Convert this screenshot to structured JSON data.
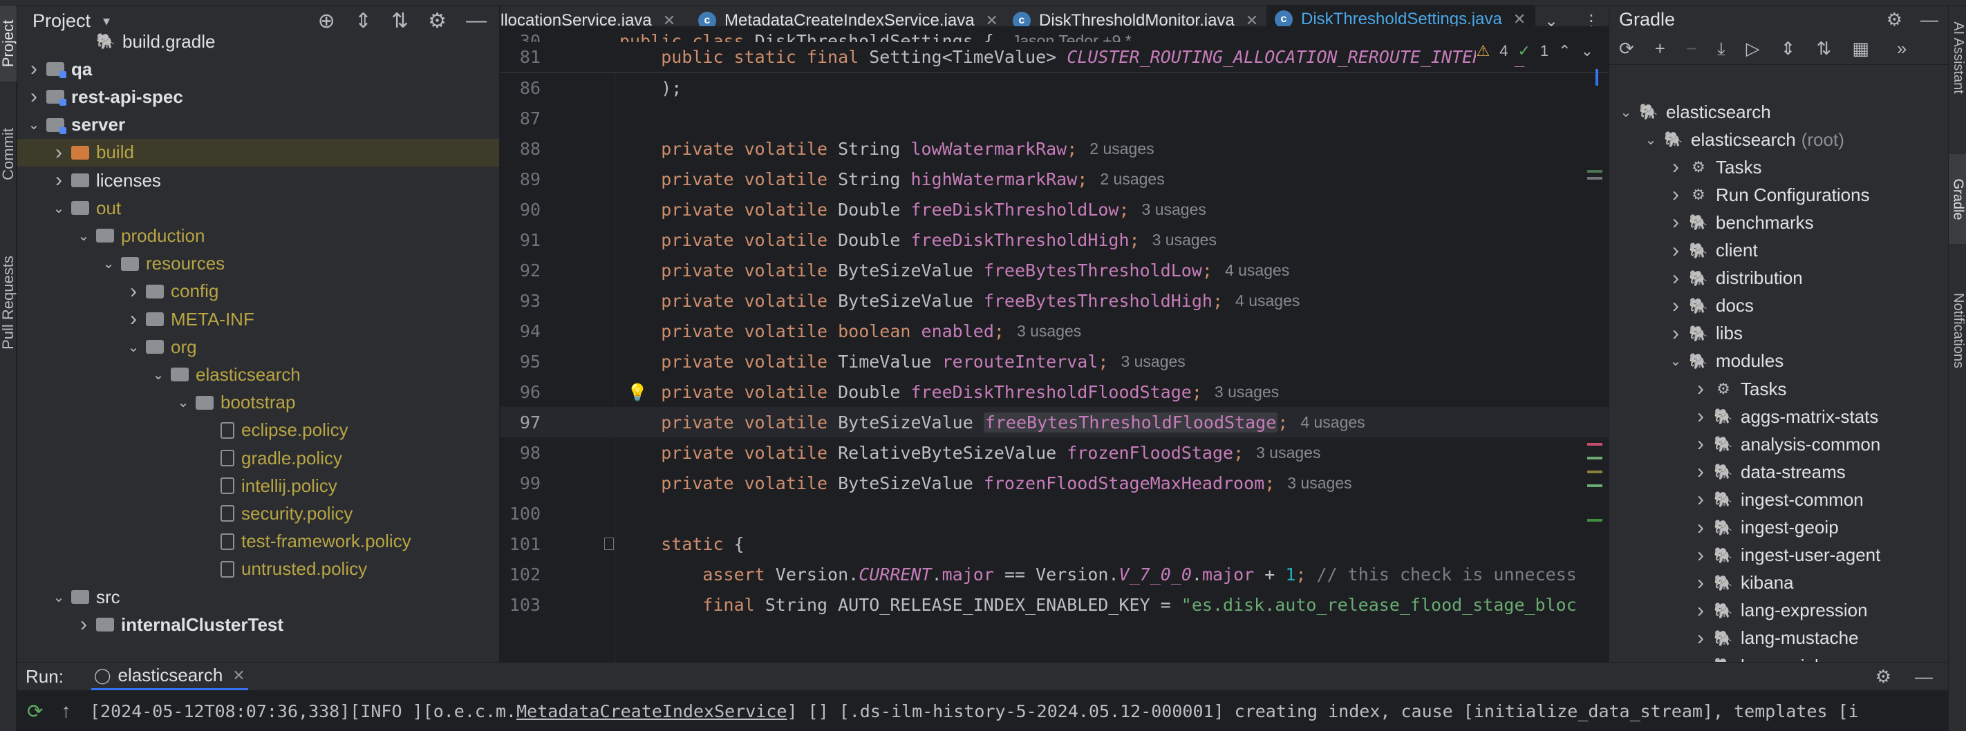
{
  "left_stripe": {
    "tabs": [
      "Project",
      "Commit",
      "Pull Requests"
    ]
  },
  "right_stripe": {
    "tabs": [
      "AI Assistant",
      "Gradle",
      "Notifications"
    ]
  },
  "project_panel": {
    "title": "Project",
    "tree": [
      {
        "label": "build.gradle",
        "kind": "gradle",
        "indent": 3,
        "arrow": ""
      },
      {
        "label": "qa",
        "kind": "mod",
        "indent": 1,
        "arrow": "right",
        "style": "bold"
      },
      {
        "label": "rest-api-spec",
        "kind": "mod",
        "indent": 1,
        "arrow": "right",
        "style": "bold"
      },
      {
        "label": "server",
        "kind": "mod",
        "indent": 1,
        "arrow": "down",
        "style": "bold"
      },
      {
        "label": "build",
        "kind": "orange",
        "indent": 2,
        "arrow": "right",
        "style": "yellow",
        "highlight": true
      },
      {
        "label": "licenses",
        "kind": "grey",
        "indent": 2,
        "arrow": "right",
        "style": "normal"
      },
      {
        "label": "out",
        "kind": "grey",
        "indent": 2,
        "arrow": "down",
        "style": "yellow"
      },
      {
        "label": "production",
        "kind": "grey",
        "indent": 3,
        "arrow": "down",
        "style": "yellow"
      },
      {
        "label": "resources",
        "kind": "grey",
        "indent": 4,
        "arrow": "down",
        "style": "yellow"
      },
      {
        "label": "config",
        "kind": "grey",
        "indent": 5,
        "arrow": "right",
        "style": "yellow"
      },
      {
        "label": "META-INF",
        "kind": "grey",
        "indent": 5,
        "arrow": "right",
        "style": "yellow"
      },
      {
        "label": "org",
        "kind": "grey",
        "indent": 5,
        "arrow": "down",
        "style": "yellow"
      },
      {
        "label": "elasticsearch",
        "kind": "grey",
        "indent": 6,
        "arrow": "down",
        "style": "yellow"
      },
      {
        "label": "bootstrap",
        "kind": "grey",
        "indent": 7,
        "arrow": "down",
        "style": "yellow"
      },
      {
        "label": "eclipse.policy",
        "kind": "file",
        "indent": 8,
        "arrow": "",
        "style": "yellow"
      },
      {
        "label": "gradle.policy",
        "kind": "file",
        "indent": 8,
        "arrow": "",
        "style": "yellow"
      },
      {
        "label": "intellij.policy",
        "kind": "file",
        "indent": 8,
        "arrow": "",
        "style": "yellow"
      },
      {
        "label": "security.policy",
        "kind": "file",
        "indent": 8,
        "arrow": "",
        "style": "yellow"
      },
      {
        "label": "test-framework.policy",
        "kind": "file",
        "indent": 8,
        "arrow": "",
        "style": "yellow"
      },
      {
        "label": "untrusted.policy",
        "kind": "file",
        "indent": 8,
        "arrow": "",
        "style": "yellow"
      },
      {
        "label": "src",
        "kind": "grey",
        "indent": 2,
        "arrow": "down",
        "style": "normal"
      },
      {
        "label": "internalClusterTest",
        "kind": "grey",
        "indent": 3,
        "arrow": "right",
        "style": "bold"
      }
    ]
  },
  "editor": {
    "tabs": [
      {
        "label": "llocationService.java",
        "active": false
      },
      {
        "label": "MetadataCreateIndexService.java",
        "active": false
      },
      {
        "label": "DiskThresholdMonitor.java",
        "active": false
      },
      {
        "label": "DiskThresholdSettings.java",
        "active": true
      }
    ],
    "inspection": {
      "warnings": "4",
      "ok": "1"
    },
    "author_hint": "Jason Tedor +9 *",
    "lines": [
      {
        "n": "30",
        "sticky": true,
        "tokens": [
          [
            "kw",
            "public class "
          ],
          [
            "ty",
            "DiskThresholdSettings "
          ],
          [
            "plain",
            "{"
          ]
        ],
        "author": true
      },
      {
        "n": "81",
        "sticky": true,
        "tokens": [
          [
            "plain",
            "    "
          ],
          [
            "kw",
            "public static final "
          ],
          [
            "ty",
            "Setting<TimeValue> "
          ],
          [
            "fldi",
            "CLUSTER_ROUTING_ALLOCATION_REROUTE_INTERVAL_SETTI"
          ]
        ]
      },
      {
        "n": "86",
        "tokens": [
          [
            "plain",
            "    );"
          ]
        ]
      },
      {
        "n": "87",
        "tokens": []
      },
      {
        "n": "88",
        "tokens": [
          [
            "plain",
            "    "
          ],
          [
            "kw",
            "private volatile "
          ],
          [
            "ty",
            "String "
          ],
          [
            "fld",
            "lowWatermarkRaw"
          ],
          [
            "pun",
            ";"
          ]
        ],
        "usages": "2 usages"
      },
      {
        "n": "89",
        "tokens": [
          [
            "plain",
            "    "
          ],
          [
            "kw",
            "private volatile "
          ],
          [
            "ty",
            "String "
          ],
          [
            "fld",
            "highWatermarkRaw"
          ],
          [
            "pun",
            ";"
          ]
        ],
        "usages": "2 usages"
      },
      {
        "n": "90",
        "tokens": [
          [
            "plain",
            "    "
          ],
          [
            "kw",
            "private volatile "
          ],
          [
            "ty",
            "Double "
          ],
          [
            "fld",
            "freeDiskThresholdLow"
          ],
          [
            "pun",
            ";"
          ]
        ],
        "usages": "3 usages"
      },
      {
        "n": "91",
        "tokens": [
          [
            "plain",
            "    "
          ],
          [
            "kw",
            "private volatile "
          ],
          [
            "ty",
            "Double "
          ],
          [
            "fld",
            "freeDiskThresholdHigh"
          ],
          [
            "pun",
            ";"
          ]
        ],
        "usages": "3 usages"
      },
      {
        "n": "92",
        "tokens": [
          [
            "plain",
            "    "
          ],
          [
            "kw",
            "private volatile "
          ],
          [
            "ty",
            "ByteSizeValue "
          ],
          [
            "fld",
            "freeBytesThresholdLow"
          ],
          [
            "pun",
            ";"
          ]
        ],
        "usages": "4 usages"
      },
      {
        "n": "93",
        "tokens": [
          [
            "plain",
            "    "
          ],
          [
            "kw",
            "private volatile "
          ],
          [
            "ty",
            "ByteSizeValue "
          ],
          [
            "fld",
            "freeBytesThresholdHigh"
          ],
          [
            "pun",
            ";"
          ]
        ],
        "usages": "4 usages"
      },
      {
        "n": "94",
        "tokens": [
          [
            "plain",
            "    "
          ],
          [
            "kw",
            "private volatile boolean "
          ],
          [
            "fld",
            "enabled"
          ],
          [
            "pun",
            ";"
          ]
        ],
        "usages": "3 usages"
      },
      {
        "n": "95",
        "tokens": [
          [
            "plain",
            "    "
          ],
          [
            "kw",
            "private volatile "
          ],
          [
            "ty",
            "TimeValue "
          ],
          [
            "fld",
            "rerouteInterval"
          ],
          [
            "pun",
            ";"
          ]
        ],
        "usages": "3 usages"
      },
      {
        "n": "96",
        "tokens": [
          [
            "plain",
            "    "
          ],
          [
            "kw",
            "private volatile "
          ],
          [
            "ty",
            "Double "
          ],
          [
            "fld",
            "freeDiskThresholdFloodStage"
          ],
          [
            "pun",
            ";"
          ]
        ],
        "usages": "3 usages",
        "bulb": true
      },
      {
        "n": "97",
        "tokens": [
          [
            "plain",
            "    "
          ],
          [
            "kw",
            "private volatile "
          ],
          [
            "ty",
            "ByteSizeValue "
          ],
          [
            "fldbox",
            "freeBytesThresholdFloodStage"
          ],
          [
            "pun",
            ";"
          ]
        ],
        "usages": "4 usages",
        "current": true
      },
      {
        "n": "98",
        "tokens": [
          [
            "plain",
            "    "
          ],
          [
            "kw",
            "private volatile "
          ],
          [
            "ty",
            "RelativeByteSizeValue "
          ],
          [
            "fld",
            "frozenFloodStage"
          ],
          [
            "pun",
            ";"
          ]
        ],
        "usages": "3 usages"
      },
      {
        "n": "99",
        "tokens": [
          [
            "plain",
            "    "
          ],
          [
            "kw",
            "private volatile "
          ],
          [
            "ty",
            "ByteSizeValue "
          ],
          [
            "fld",
            "frozenFloodStageMaxHeadroom"
          ],
          [
            "pun",
            ";"
          ]
        ],
        "usages": "3 usages"
      },
      {
        "n": "100",
        "tokens": []
      },
      {
        "n": "101",
        "tokens": [
          [
            "plain",
            "    "
          ],
          [
            "kw",
            "static "
          ],
          [
            "plain",
            "{"
          ]
        ],
        "fold": true
      },
      {
        "n": "102",
        "tokens": [
          [
            "plain",
            "        "
          ],
          [
            "kw",
            "assert "
          ],
          [
            "ty",
            "Version."
          ],
          [
            "fldi",
            "CURRENT"
          ],
          [
            "ty",
            "."
          ],
          [
            "fld",
            "major"
          ],
          [
            "ty",
            " == Version."
          ],
          [
            "fldi",
            "V_7_0_0"
          ],
          [
            "ty",
            "."
          ],
          [
            "fld",
            "major"
          ],
          [
            "ty",
            " + "
          ],
          [
            "num",
            "1"
          ],
          [
            "pun",
            "; "
          ],
          [
            "cmt",
            "// this check is unnecess"
          ]
        ]
      },
      {
        "n": "103",
        "tokens": [
          [
            "plain",
            "        "
          ],
          [
            "kw",
            "final "
          ],
          [
            "ty",
            "String AUTO_RELEASE_INDEX_ENABLED_KEY = "
          ],
          [
            "str",
            "\"es.disk.auto_release_flood_stage_bloc"
          ]
        ]
      }
    ]
  },
  "gradle_panel": {
    "title": "Gradle",
    "tree": [
      {
        "label": "elasticsearch",
        "indent": 0,
        "arrow": "down",
        "icon": "elephant"
      },
      {
        "label": "elasticsearch",
        "sub": "(root)",
        "indent": 1,
        "arrow": "down",
        "icon": "elephant"
      },
      {
        "label": "Tasks",
        "indent": 2,
        "arrow": "right",
        "icon": "tasks"
      },
      {
        "label": "Run Configurations",
        "indent": 2,
        "arrow": "right",
        "icon": "tasks"
      },
      {
        "label": "benchmarks",
        "indent": 2,
        "arrow": "right",
        "icon": "elephant"
      },
      {
        "label": "client",
        "indent": 2,
        "arrow": "right",
        "icon": "elephant"
      },
      {
        "label": "distribution",
        "indent": 2,
        "arrow": "right",
        "icon": "elephant"
      },
      {
        "label": "docs",
        "indent": 2,
        "arrow": "right",
        "icon": "elephant"
      },
      {
        "label": "libs",
        "indent": 2,
        "arrow": "right",
        "icon": "elephant"
      },
      {
        "label": "modules",
        "indent": 2,
        "arrow": "down",
        "icon": "elephant"
      },
      {
        "label": "Tasks",
        "indent": 3,
        "arrow": "right",
        "icon": "tasks"
      },
      {
        "label": "aggs-matrix-stats",
        "indent": 3,
        "arrow": "right",
        "icon": "elephant"
      },
      {
        "label": "analysis-common",
        "indent": 3,
        "arrow": "right",
        "icon": "elephant"
      },
      {
        "label": "data-streams",
        "indent": 3,
        "arrow": "right",
        "icon": "elephant"
      },
      {
        "label": "ingest-common",
        "indent": 3,
        "arrow": "right",
        "icon": "elephant"
      },
      {
        "label": "ingest-geoip",
        "indent": 3,
        "arrow": "right",
        "icon": "elephant"
      },
      {
        "label": "ingest-user-agent",
        "indent": 3,
        "arrow": "right",
        "icon": "elephant"
      },
      {
        "label": "kibana",
        "indent": 3,
        "arrow": "right",
        "icon": "elephant"
      },
      {
        "label": "lang-expression",
        "indent": 3,
        "arrow": "right",
        "icon": "elephant"
      },
      {
        "label": "lang-mustache",
        "indent": 3,
        "arrow": "right",
        "icon": "elephant"
      },
      {
        "label": "lang-painless",
        "indent": 3,
        "arrow": "right",
        "icon": "elephant"
      }
    ]
  },
  "run_panel": {
    "label": "Run:",
    "tab": "elasticsearch",
    "log_prefix": "[2024-05-12T08:07:36,338][INFO ][o.e.c.m.",
    "log_link": "MetadataCreateIndexService",
    "log_suffix": "] [] [.ds-ilm-history-5-2024.05.12-000001] creating index, cause [initialize_data_stream], templates [i"
  },
  "colors": {
    "accent": "#3574f0",
    "keyword": "#cf8e6d",
    "field": "#c77dbb",
    "string": "#6aab73",
    "number": "#2aacb8",
    "comment": "#7a7e85"
  }
}
